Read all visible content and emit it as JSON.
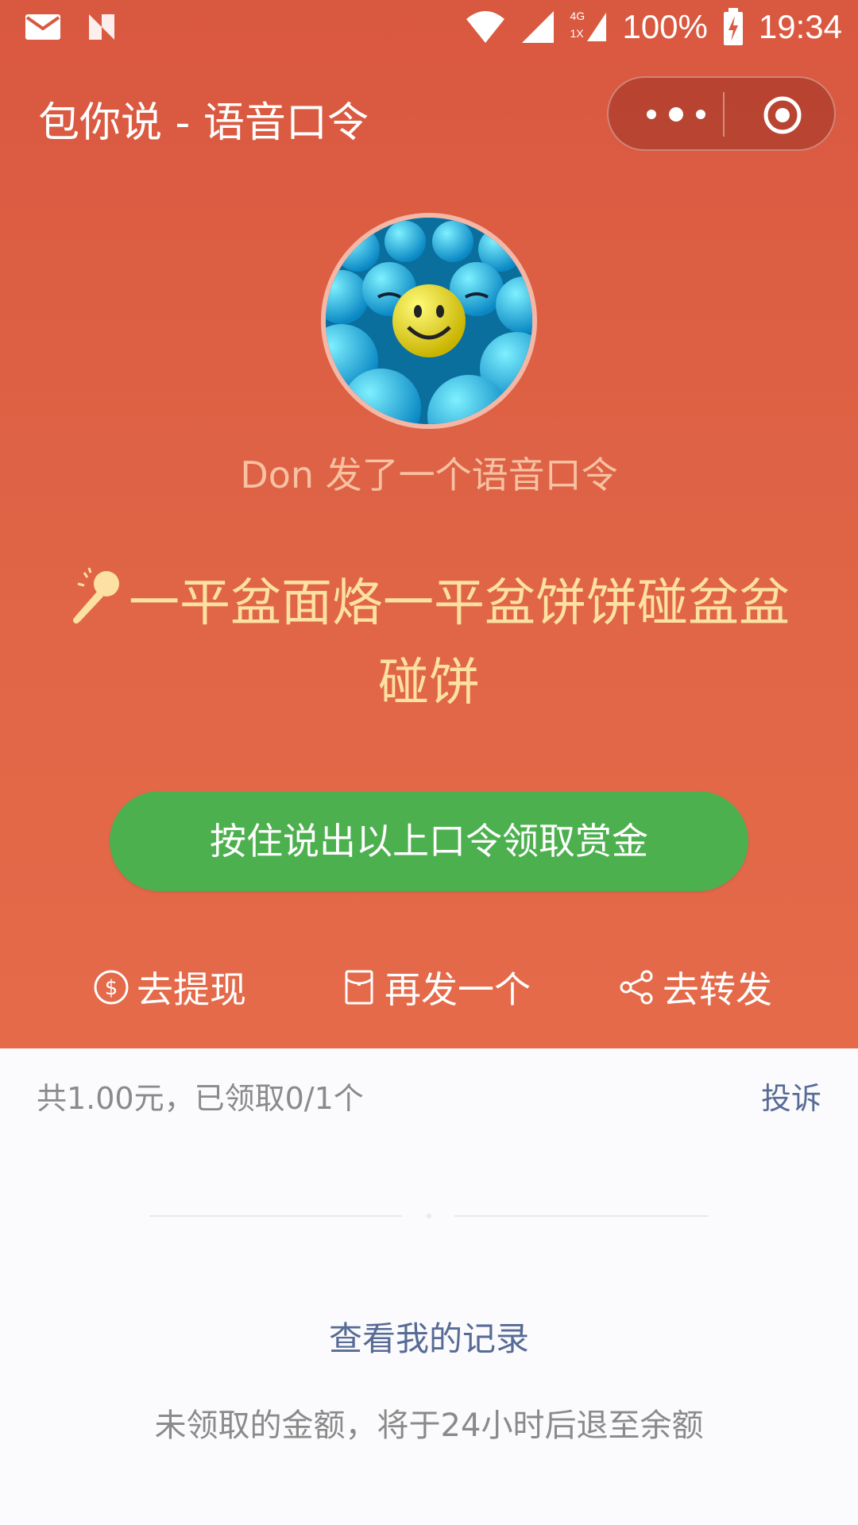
{
  "status_bar": {
    "battery": "100%",
    "time": "19:34",
    "network": "4G",
    "sim": "1X",
    "icons": [
      "mail-icon",
      "n-app-icon",
      "wifi-icon",
      "signal-icon",
      "battery-charging-icon"
    ]
  },
  "nav": {
    "title": "包你说 - 语音口令",
    "more_icon": "more-dots-icon",
    "close_icon": "target-close-icon"
  },
  "header": {
    "sender": "Don 发了一个语音口令",
    "command": "一平盆面烙一平盆饼饼碰盆盆碰饼",
    "mic_icon": "microphone-icon"
  },
  "main": {
    "press_button": "按住说出以上口令领取赏金"
  },
  "actions": [
    {
      "label": "去提现",
      "icon": "dollar-circle-icon"
    },
    {
      "label": "再发一个",
      "icon": "red-envelope-icon"
    },
    {
      "label": "去转发",
      "icon": "share-icon"
    }
  ],
  "details": {
    "summary": "共1.00元，已领取0/1个",
    "report": "投诉",
    "records": "查看我的记录",
    "notice": "未领取的金额，将于24小时后退至余额"
  },
  "colors": {
    "header_bg": "#d95840",
    "button_green": "#4db04f",
    "command_text": "#fde0a4",
    "link_blue": "#576b95"
  }
}
